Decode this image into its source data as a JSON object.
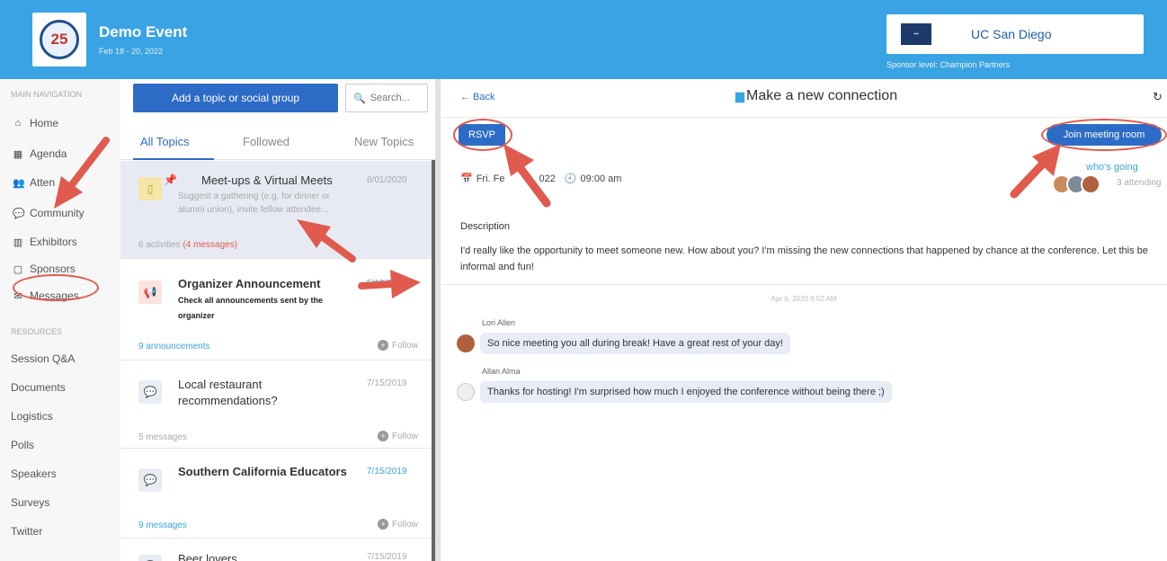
{
  "header": {
    "event_name": "Demo Event",
    "event_dates": "Feb 18 - 20, 2022",
    "logo_text": "25",
    "sponsor_name": "UC San Diego",
    "sponsor_level": "Sponsor level: Champion Partners"
  },
  "nav": {
    "main_heading": "MAIN NAVIGATION",
    "items": [
      {
        "label": "Home",
        "icon": "home-icon"
      },
      {
        "label": "Agenda",
        "icon": "calendar-icon"
      },
      {
        "label": "Atten",
        "icon": "attendees-icon"
      },
      {
        "label": "Community",
        "icon": "community-icon"
      },
      {
        "label": "Exhibitors",
        "icon": "exhibitors-icon"
      },
      {
        "label": "Sponsors",
        "icon": "sponsors-icon"
      },
      {
        "label": "Messages",
        "icon": "messages-icon"
      }
    ],
    "resources_heading": "RESOURCES",
    "resources": [
      "Session Q&A",
      "Documents",
      "Logistics",
      "Polls",
      "Speakers",
      "Surveys",
      "Twitter"
    ]
  },
  "topics": {
    "add_button": "Add a topic or social group",
    "search_placeholder": "Search...",
    "tabs": [
      "All Topics",
      "Followed",
      "New Topics"
    ],
    "follow_label": "Follow",
    "items": [
      {
        "title": "Meet-ups & Virtual Meets",
        "date": "6/01/2020",
        "description": "Suggest a gathering (e.g. for dinner or alumni union), invite fellow attendee...",
        "activities": "6 activities",
        "messages": "(4 messages)"
      },
      {
        "title": "Organizer Announcement",
        "date": "5/13/2020",
        "description": "Check all announcements sent by the organizer",
        "meta": "9 announcements"
      },
      {
        "title": "Local restaurant recommendations?",
        "date": "7/15/2019",
        "meta": "5 messages"
      },
      {
        "title": "Southern California Educators",
        "date": "7/15/2019",
        "meta": "9 messages"
      },
      {
        "title": "Beer lovers",
        "date": "7/15/2019"
      }
    ]
  },
  "detail": {
    "back": "← Back",
    "title": "Make a new connection",
    "rsvp": "RSVP",
    "join": "Join meeting room",
    "date": "Fri. Fe",
    "date_rest": "022",
    "time": "09:00 am",
    "whos_going": "who's going",
    "attending": "3 attending",
    "description_label": "Description",
    "description": "I'd really like the opportunity to meet someone new. How about you? I'm missing the new connections that happened by chance at the conference. Let this be informal and fun!",
    "timestamp": "Apr 6, 2020 8:52 AM",
    "messages": [
      {
        "author": "Lori Allen",
        "text": "So nice meeting you all during break! Have a great rest of your day!"
      },
      {
        "author": "Allan Alma",
        "text": "Thanks for hosting! I'm surprised how much I enjoyed the conference without being there ;)"
      }
    ]
  },
  "colors": {
    "header": "#3aa3e3",
    "primary": "#2d6cc6",
    "annotation": "#e05a4e"
  }
}
